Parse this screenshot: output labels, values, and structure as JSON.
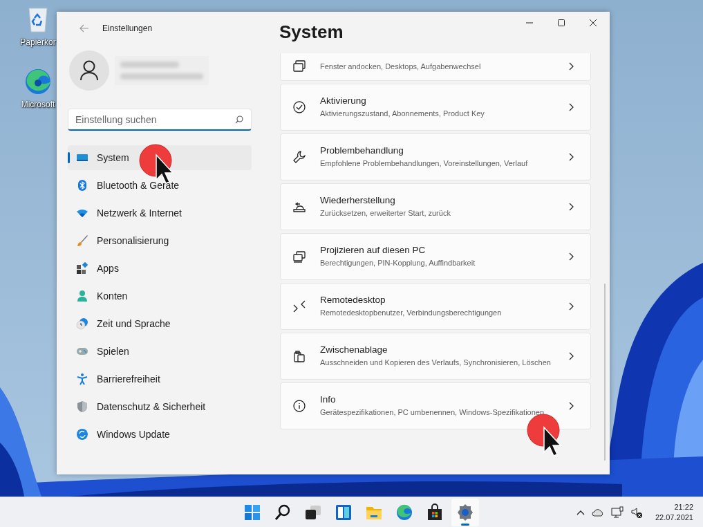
{
  "desktop": {
    "icons": [
      {
        "label": "Papierkor",
        "kind": "recycle"
      },
      {
        "label": "Microsoft",
        "kind": "edge"
      }
    ]
  },
  "window": {
    "title": "Einstellungen",
    "page_title": "System"
  },
  "search": {
    "placeholder": "Einstellung suchen"
  },
  "sidebar": {
    "items": [
      {
        "label": "System",
        "selected": true
      },
      {
        "label": "Bluetooth & Geräte",
        "selected": false
      },
      {
        "label": "Netzwerk & Internet",
        "selected": false
      },
      {
        "label": "Personalisierung",
        "selected": false
      },
      {
        "label": "Apps",
        "selected": false
      },
      {
        "label": "Konten",
        "selected": false
      },
      {
        "label": "Zeit und Sprache",
        "selected": false
      },
      {
        "label": "Spielen",
        "selected": false
      },
      {
        "label": "Barrierefreiheit",
        "selected": false
      },
      {
        "label": "Datenschutz & Sicherheit",
        "selected": false
      },
      {
        "label": "Windows Update",
        "selected": false
      }
    ]
  },
  "cards": [
    {
      "subtitle": "Fenster andocken, Desktops, Aufgabenwechsel"
    },
    {
      "title": "Aktivierung",
      "subtitle": "Aktivierungszustand, Abonnements, Product Key"
    },
    {
      "title": "Problembehandlung",
      "subtitle": "Empfohlene Problembehandlungen, Voreinstellungen, Verlauf"
    },
    {
      "title": "Wiederherstellung",
      "subtitle": "Zurücksetzen, erweiterter Start, zurück"
    },
    {
      "title": "Projizieren auf diesen PC",
      "subtitle": "Berechtigungen, PIN-Kopplung, Auffindbarkeit"
    },
    {
      "title": "Remotedesktop",
      "subtitle": "Remotedesktopbenutzer, Verbindungsberechtigungen"
    },
    {
      "title": "Zwischenablage",
      "subtitle": "Ausschneiden und Kopieren des Verlaufs, Synchronisieren, Löschen"
    },
    {
      "title": "Info",
      "subtitle": "Gerätespezifikationen, PC umbenennen, Windows-Spezifikationen"
    }
  ],
  "taskbar": {
    "apps": [
      {
        "kind": "start",
        "selected": false
      },
      {
        "kind": "search",
        "selected": false
      },
      {
        "kind": "taskview",
        "selected": false
      },
      {
        "kind": "widgets",
        "selected": false
      },
      {
        "kind": "explorer",
        "selected": false
      },
      {
        "kind": "edge",
        "selected": false
      },
      {
        "kind": "store",
        "selected": false
      },
      {
        "kind": "settings",
        "selected": true
      }
    ],
    "time": "21:22",
    "date": "22.07.2021"
  }
}
